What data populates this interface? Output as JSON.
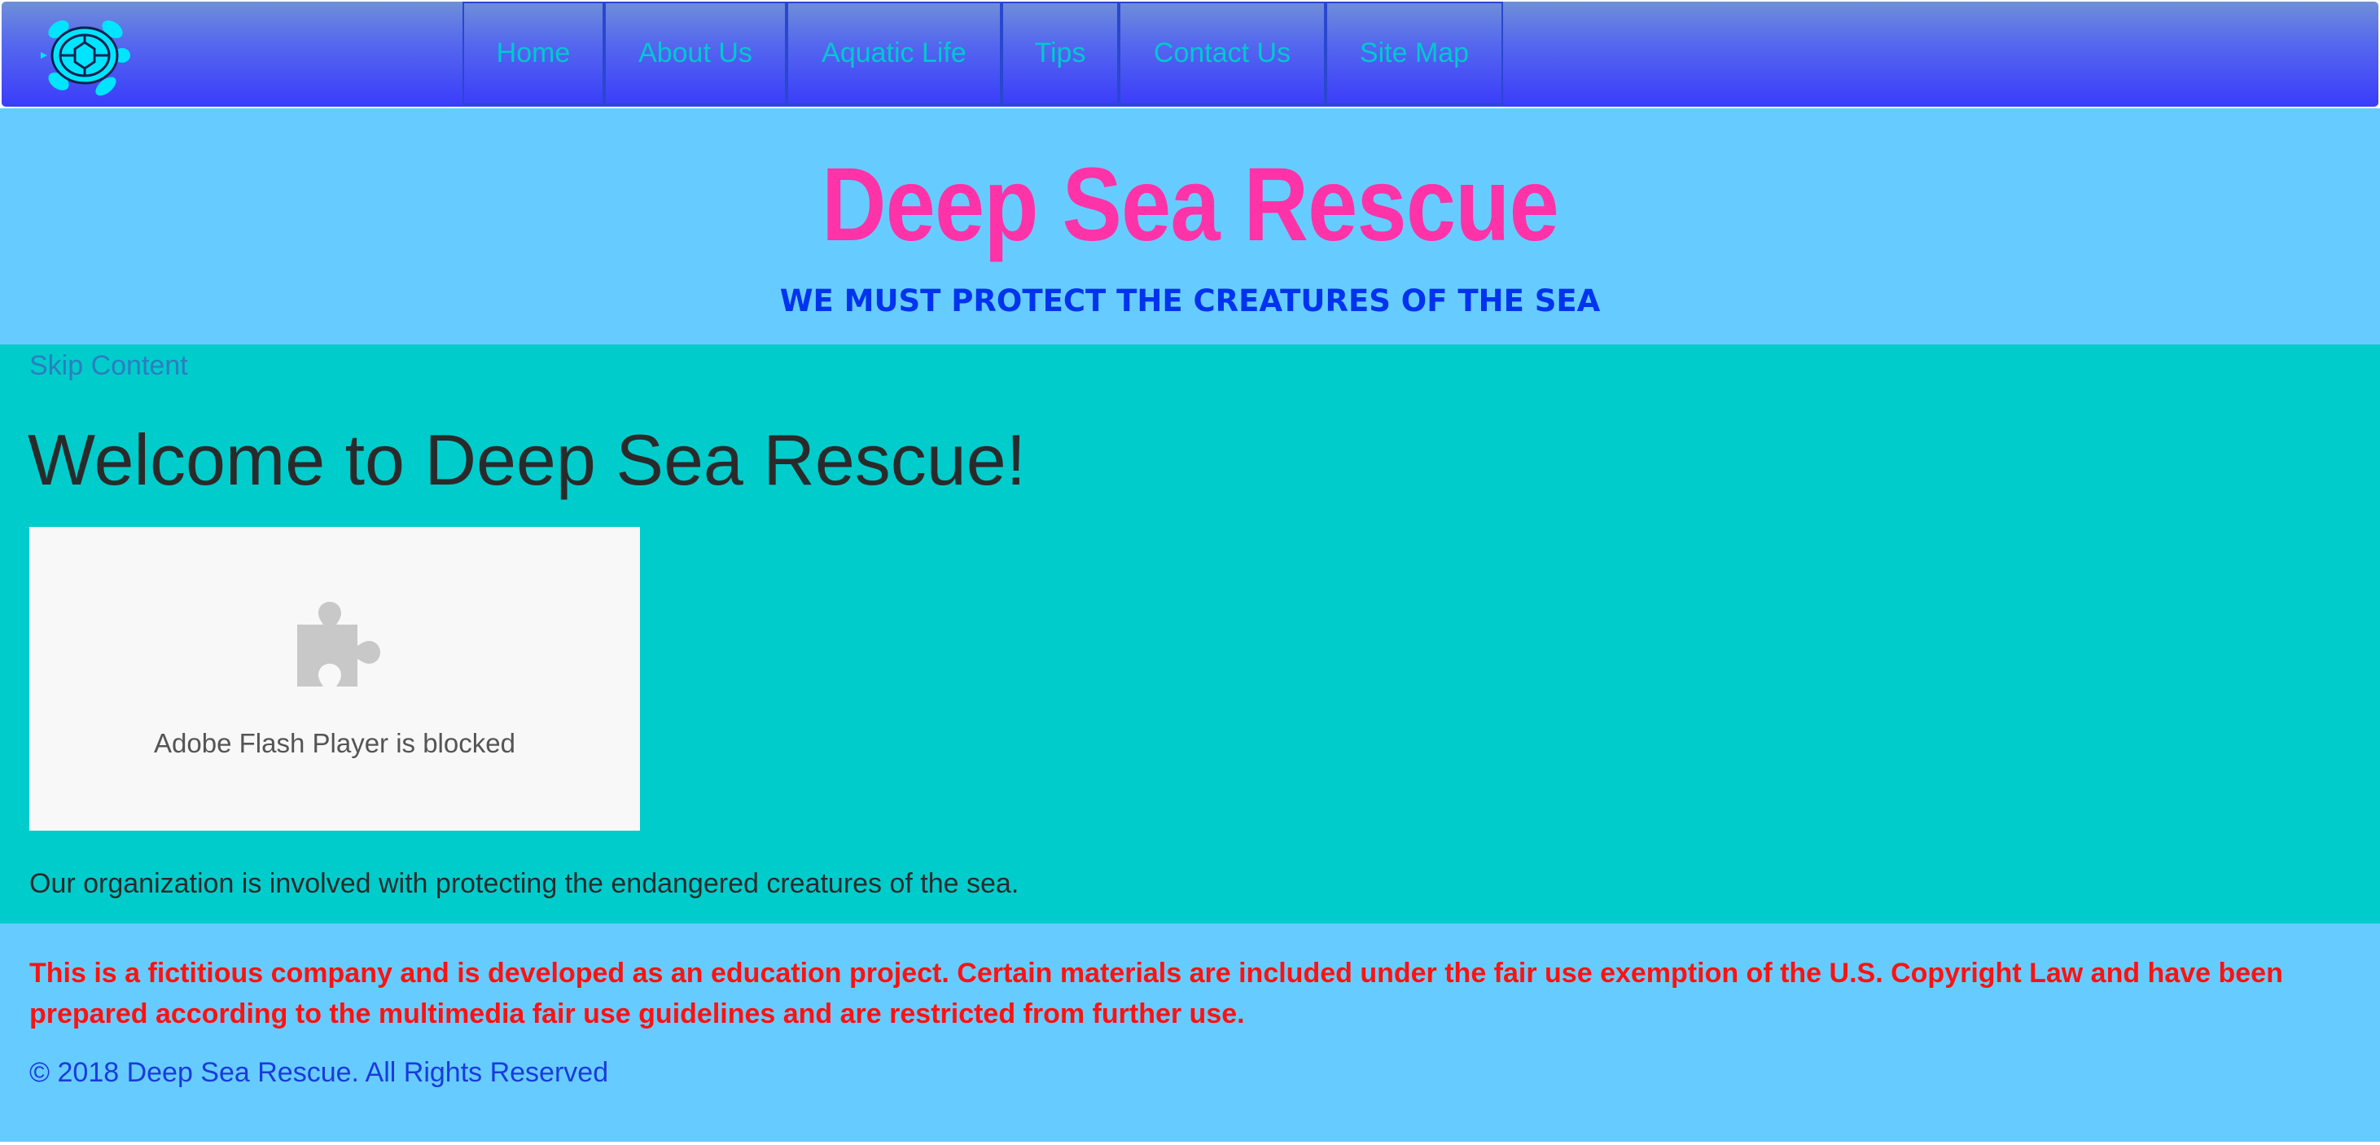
{
  "nav": {
    "logo_icon": "sea-turtle-icon",
    "items": [
      {
        "label": "Home"
      },
      {
        "label": "About Us"
      },
      {
        "label": "Aquatic Life"
      },
      {
        "label": "Tips"
      },
      {
        "label": "Contact Us"
      },
      {
        "label": "Site Map"
      }
    ]
  },
  "header": {
    "title": "Deep Sea Rescue",
    "tagline": "WE MUST PROTECT THE CREATURES OF THE SEA"
  },
  "main": {
    "skip_link": "Skip Content",
    "heading": "Welcome to Deep Sea Rescue!",
    "plugin": {
      "icon": "puzzle-piece-icon",
      "message": "Adobe Flash Player is blocked"
    },
    "intro": "Our organization is involved with protecting the endangered creatures of the sea."
  },
  "footer": {
    "disclaimer": "This is a fictitious company and is developed as an education project. Certain materials are included under the fair use exemption of the U.S. Copyright Law and have been prepared according to the multimedia fair use guidelines and are restricted from further use.",
    "copyright": "© 2018 Deep Sea Rescue. All Rights Reserved"
  },
  "colors": {
    "nav_text": "#00c9cf",
    "title": "#ff33a8",
    "tagline": "#0033ee",
    "banner_bg": "#66ccff",
    "main_bg": "#00cccc",
    "disclaimer": "#ff1111",
    "copyright": "#1a3bdd"
  }
}
